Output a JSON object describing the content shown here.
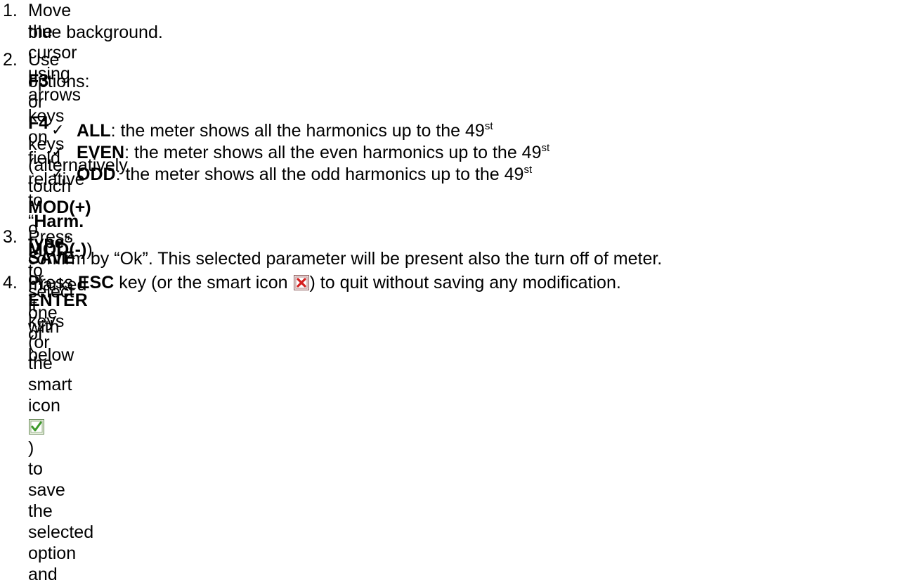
{
  "steps": [
    {
      "num": "1.",
      "line1": {
        "a": "Move the cursor using arrows keys on field relative to “",
        "b1": "Harm. type",
        "c": "” , marked it with"
      },
      "line2": "blue background."
    },
    {
      "num": "2.",
      "line1": {
        "a": "Use ",
        "b1": "F3",
        "c": " or ",
        "b2": "F4",
        "d": " keys (alternatively touch ",
        "b3": "MOD(+)",
        "e": " o ",
        "b4": "MOD(-)",
        "f": ") to select one of below"
      },
      "line2": "options:"
    },
    {
      "num": "3.",
      "line1": {
        "a": "Press ",
        "b1": "SAVE",
        "c": " or ",
        "b2": "ENTER",
        "d": " keys (or the smart icon ",
        "e": ") to save the selected option and"
      },
      "line2": "confirm by “Ok”. This selected parameter will be present also the turn off of meter."
    },
    {
      "num": "4.",
      "line1": {
        "a": "Press ",
        "b1": "ESC",
        "c": " key (or the smart icon ",
        "d": ") to quit without saving any modification."
      }
    }
  ],
  "options": [
    {
      "check": "✓",
      "label": "ALL",
      "text": ": the meter shows all the harmonics up to the 49",
      "sup": "st"
    },
    {
      "check": "✓",
      "label": "EVEN",
      "text": ": the meter shows all the even harmonics up to the 49",
      "sup": "st"
    },
    {
      "check": "✓",
      "label": "ODD",
      "text": ": the meter shows all the odd harmonics up to the 49",
      "sup": "st"
    }
  ],
  "icons": {
    "confirm": "green-check-icon",
    "cancel": "red-x-icon"
  },
  "colors": {
    "confirm_icon": "#3c9a2a",
    "cancel_icon": "#d42020"
  }
}
